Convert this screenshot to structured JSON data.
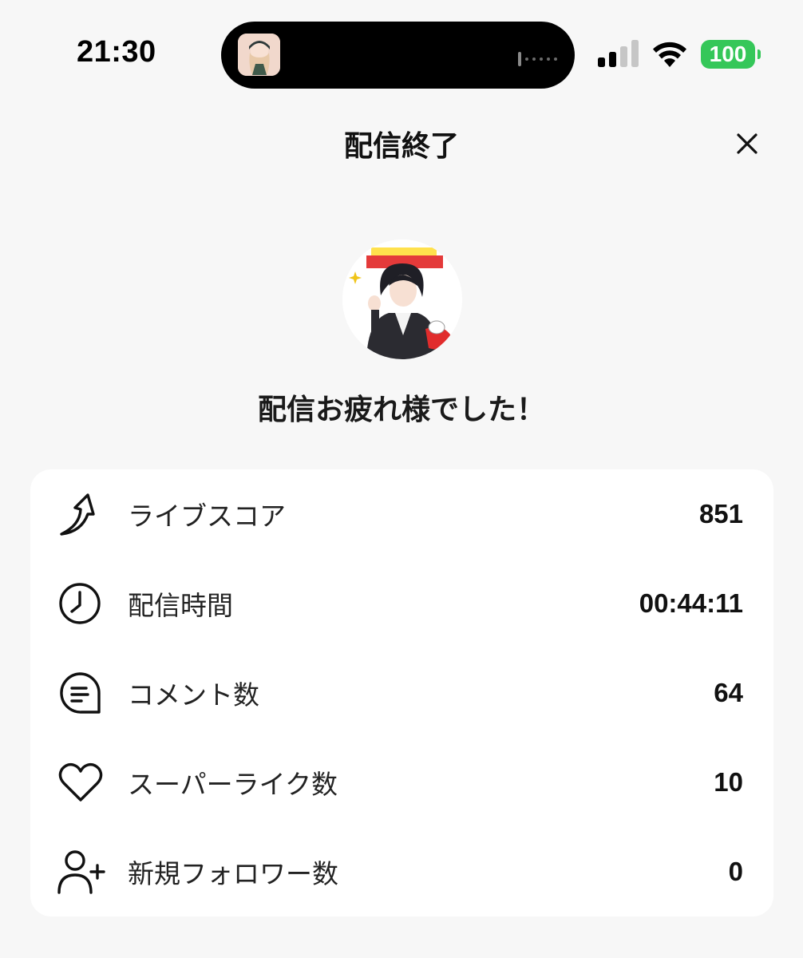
{
  "status_bar": {
    "time": "21:30",
    "battery": "100",
    "icons": [
      "cellular-signal-icon",
      "wifi-icon",
      "battery-icon"
    ],
    "battery_color": "#35c759"
  },
  "header": {
    "title": "配信終了",
    "close_icon": "close-icon"
  },
  "main": {
    "message": "配信お疲れ様でした！"
  },
  "stats": [
    {
      "icon": "live-score-icon",
      "label": "ライブスコア",
      "value": "851"
    },
    {
      "icon": "clock-icon",
      "label": "配信時間",
      "value": "00:44:11"
    },
    {
      "icon": "comment-icon",
      "label": "コメント数",
      "value": "64"
    },
    {
      "icon": "heart-icon",
      "label": "スーパーライク数",
      "value": "10"
    },
    {
      "icon": "add-user-icon",
      "label": "新規フォロワー数",
      "value": "0"
    }
  ]
}
